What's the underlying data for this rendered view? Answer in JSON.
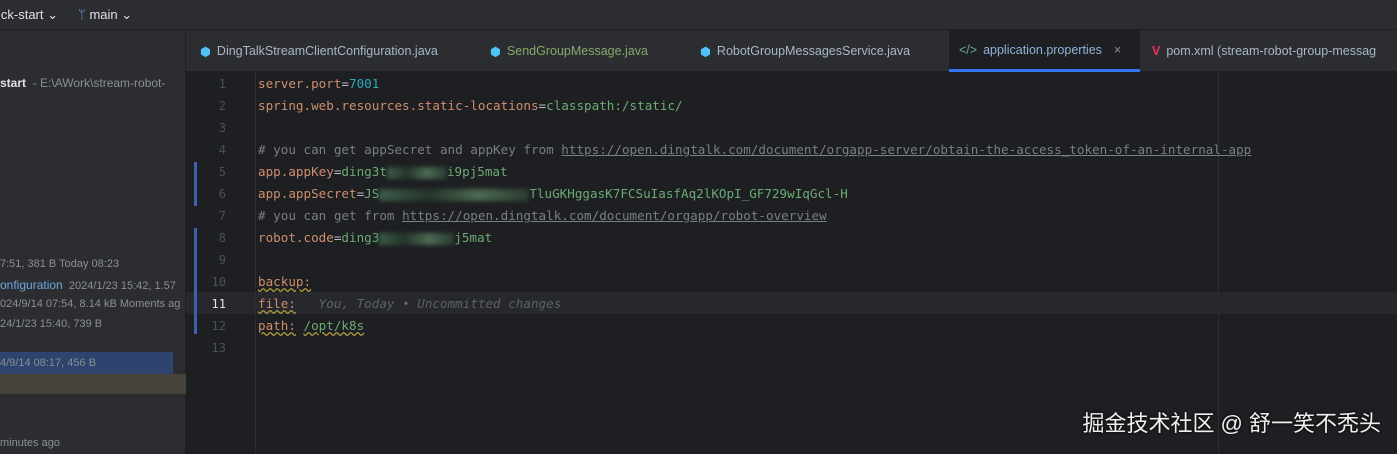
{
  "topbar": {
    "project": "ick-start",
    "branch": "main"
  },
  "sidebar": {
    "project_name": "start",
    "project_path": "- E:\\AWork\\stream-robot-",
    "rows": [
      {
        "name": "",
        "meta": "7:51, 381 B Today 08:23"
      },
      {
        "name": "onfiguration",
        "meta": "2024/1/23 15:42, 1.57"
      },
      {
        "name": "",
        "meta": "024/9/14 07:54, 8.14 kB Moments ag"
      },
      {
        "name": "",
        "meta": "24/1/23 15:40, 739 B"
      },
      {
        "name": "",
        "meta": "4/9/14 08:17, 456 B"
      },
      {
        "name": "",
        "meta": "minutes ago"
      }
    ]
  },
  "tabs": [
    {
      "label": "DingTalkStreamClientConfiguration.java",
      "icon": "java-class-icon",
      "color": "#a9b7c6"
    },
    {
      "label": "SendGroupMessage.java",
      "icon": "java-class-icon",
      "color": "#8aa86a"
    },
    {
      "label": "RobotGroupMessagesService.java",
      "icon": "java-class-icon",
      "color": "#a9b7c6"
    },
    {
      "label": "application.properties",
      "icon": "properties-icon",
      "active": true
    },
    {
      "label": "pom.xml (stream-robot-group-messag",
      "icon": "maven-icon"
    }
  ],
  "editor": {
    "l1k": "server.port",
    "l1v": "7001",
    "l2k": "spring.web.resources.static-locations",
    "l2v": "classpath:/static/",
    "l4c": "# you can get appSecret and appKey from ",
    "l4u": "https://open.dingtalk.com/document/orgapp-server/obtain-the-access_token-of-an-internal-app",
    "l5k": "app.appKey",
    "l5a": "ding3t",
    "l5b": "i9pj5mat",
    "l6k": "app.appSecret",
    "l6a": "JS",
    "l6b": "TluGKHggasK7FCSuIasfAq2lKOpI_GF729wIqGcl-H",
    "l7c": "# you can get from ",
    "l7u": "https://open.dingtalk.com/document/orgapp/robot-overview",
    "l8k": "robot.code",
    "l8a": "ding3",
    "l8b": "j5mat",
    "l10": "backup:",
    "l11": "file:",
    "blame": "You, Today • Uncommitted changes",
    "l12k": "path:",
    "l12v": "/opt/k8s",
    "eq": "="
  },
  "lines": [
    "1",
    "2",
    "3",
    "4",
    "5",
    "6",
    "7",
    "8",
    "9",
    "10",
    "11",
    "12",
    "13"
  ],
  "watermark": "掘金技术社区 @ 舒一笑不秃头",
  "close_label": "×"
}
